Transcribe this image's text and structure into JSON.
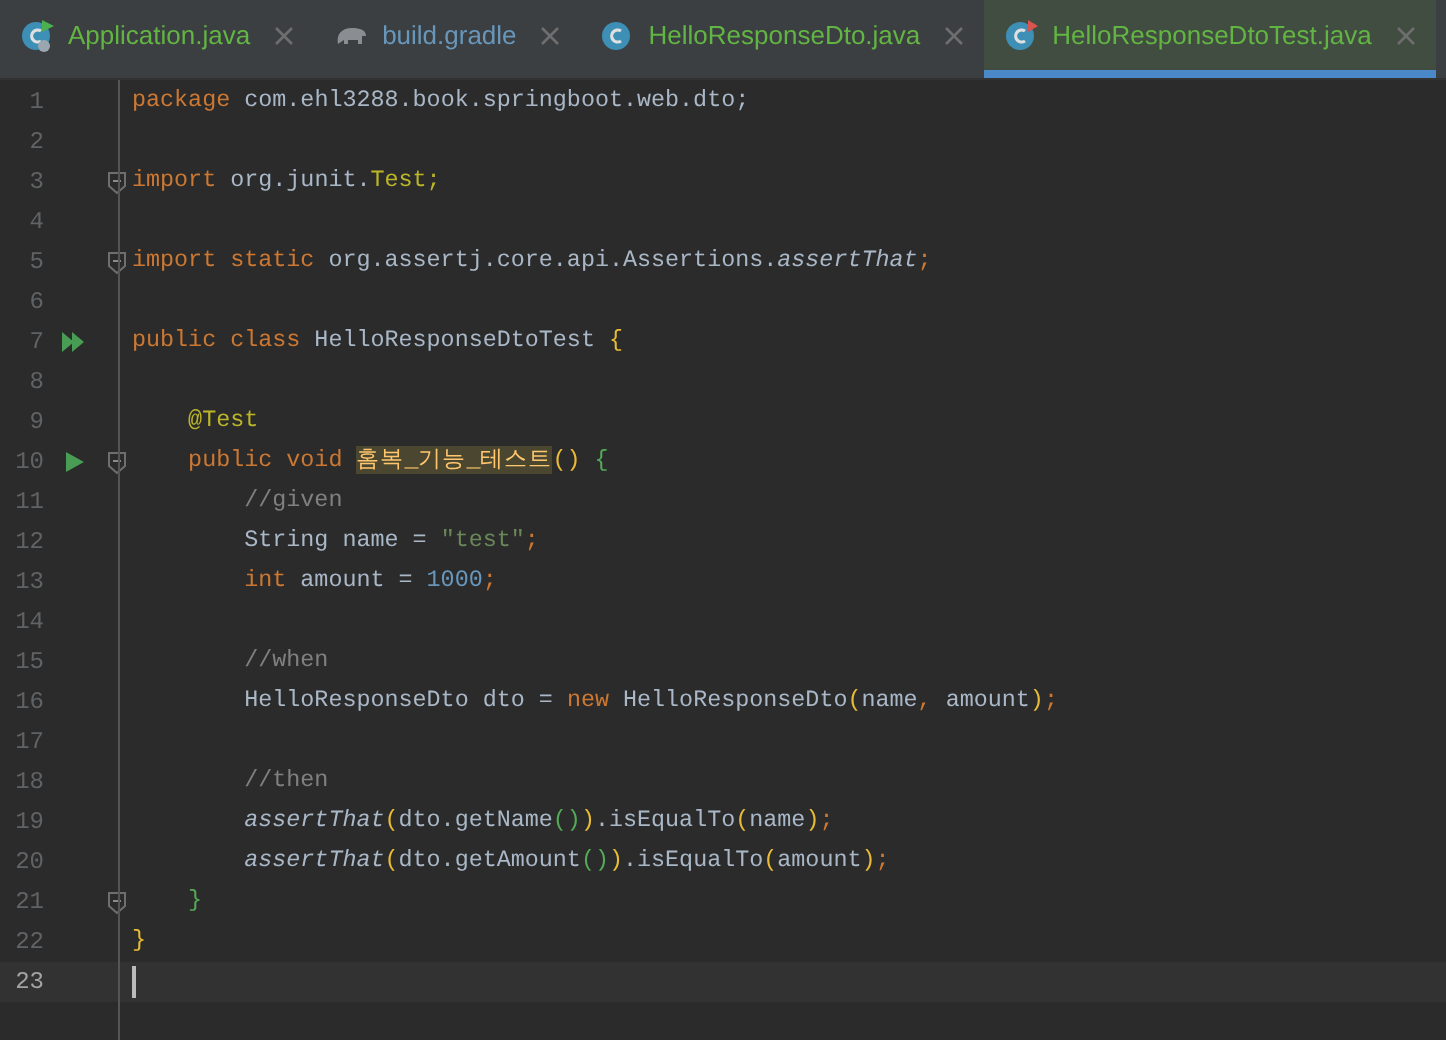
{
  "tabs": [
    {
      "label": "Application.java",
      "kind": "spring-class",
      "color": "#62b543",
      "selected": false
    },
    {
      "label": "build.gradle",
      "kind": "gradle",
      "color": "#6897bb",
      "selected": false
    },
    {
      "label": "HelloResponseDto.java",
      "kind": "class",
      "color": "#62b543",
      "selected": false
    },
    {
      "label": "HelloResponseDtoTest.java",
      "kind": "test-class",
      "color": "#62b543",
      "selected": true
    }
  ],
  "lines": [
    {
      "number": "1",
      "kind": "code",
      "fold": false,
      "current": false,
      "tokens": [
        {
          "text": "package",
          "kind": "kw"
        },
        {
          "text": " com.ehl3288.book.springboot.web.dto;",
          "kind": "plain"
        }
      ]
    },
    {
      "number": "2",
      "kind": "code",
      "fold": false,
      "current": false
    },
    {
      "number": "3",
      "kind": "code",
      "fold": true,
      "current": false,
      "tokens": [
        {
          "text": "import",
          "kind": "kw"
        },
        {
          "text": " org.junit.",
          "kind": "plain"
        },
        {
          "text": "Test;",
          "kind": "anno"
        }
      ]
    },
    {
      "number": "4",
      "kind": "code",
      "fold": false,
      "current": false
    },
    {
      "number": "5",
      "kind": "code",
      "fold": true,
      "current": false,
      "tokens": [
        {
          "text": "import static",
          "kind": "kw"
        },
        {
          "text": " org.assertj.core.api.Assertions.",
          "kind": "plain"
        },
        {
          "text": "assertThat",
          "kind": "italic"
        },
        {
          "text": ";",
          "kind": "kw"
        }
      ]
    },
    {
      "number": "6",
      "kind": "code",
      "fold": false,
      "current": false
    },
    {
      "number": "7",
      "kind": "run-all",
      "fold": false,
      "current": false,
      "tokens": [
        {
          "text": "public class",
          "kind": "kw"
        },
        {
          "text": " HelloResponseDtoTest ",
          "kind": "plain"
        },
        {
          "text": "{",
          "kind": "b1"
        }
      ]
    },
    {
      "number": "8",
      "kind": "code",
      "fold": false,
      "current": false
    },
    {
      "number": "9",
      "kind": "code",
      "fold": false,
      "current": false,
      "tokens": [
        {
          "text": "    @Test",
          "kind": "anno"
        }
      ]
    },
    {
      "number": "10",
      "kind": "run",
      "fold": true,
      "current": false,
      "tokens": [
        {
          "text": "    public void ",
          "kind": "kw"
        },
        {
          "text": "홈복_기능_테스트",
          "kind": "hl"
        },
        {
          "text": "() ",
          "kind": "b1"
        },
        {
          "text": "{",
          "kind": "b2"
        }
      ]
    },
    {
      "number": "11",
      "kind": "code",
      "fold": false,
      "current": false,
      "tokens": [
        {
          "text": "        //given",
          "kind": "comment"
        }
      ]
    },
    {
      "number": "12",
      "kind": "code",
      "fold": false,
      "current": false,
      "tokens": [
        {
          "text": "        String name = ",
          "kind": "plain"
        },
        {
          "text": "\"test\"",
          "kind": "str"
        },
        {
          "text": ";",
          "kind": "kw"
        }
      ]
    },
    {
      "number": "13",
      "kind": "code",
      "fold": false,
      "current": false,
      "tokens": [
        {
          "text": "        int",
          "kind": "kw"
        },
        {
          "text": " amount = ",
          "kind": "plain"
        },
        {
          "text": "1000",
          "kind": "num"
        },
        {
          "text": ";",
          "kind": "kw"
        }
      ]
    },
    {
      "number": "14",
      "kind": "code",
      "fold": false,
      "current": false
    },
    {
      "number": "15",
      "kind": "code",
      "fold": false,
      "current": false,
      "tokens": [
        {
          "text": "        //when",
          "kind": "comment"
        }
      ]
    },
    {
      "number": "16",
      "kind": "code",
      "fold": false,
      "current": false,
      "tokens": [
        {
          "text": "        HelloResponseDto dto = ",
          "kind": "plain"
        },
        {
          "text": "new",
          "kind": "kw"
        },
        {
          "text": " HelloResponseDto",
          "kind": "plain"
        },
        {
          "text": "(",
          "kind": "b1"
        },
        {
          "text": "name",
          "kind": "plain"
        },
        {
          "text": ",",
          "kind": "kw"
        },
        {
          "text": " amount",
          "kind": "plain"
        },
        {
          "text": ")",
          "kind": "b1"
        },
        {
          "text": ";",
          "kind": "kw"
        }
      ]
    },
    {
      "number": "17",
      "kind": "code",
      "fold": false,
      "current": false
    },
    {
      "number": "18",
      "kind": "code",
      "fold": false,
      "current": false,
      "tokens": [
        {
          "text": "        //then",
          "kind": "comment"
        }
      ]
    },
    {
      "number": "19",
      "kind": "code",
      "fold": false,
      "current": false,
      "tokens": [
        {
          "text": "        assertThat",
          "kind": "italic"
        },
        {
          "text": "(",
          "kind": "b1"
        },
        {
          "text": "dto.getName",
          "kind": "plain"
        },
        {
          "text": "()",
          "kind": "b2"
        },
        {
          "text": ")",
          "kind": "b1"
        },
        {
          "text": ".isEqualTo",
          "kind": "plain"
        },
        {
          "text": "(",
          "kind": "b1"
        },
        {
          "text": "name",
          "kind": "plain"
        },
        {
          "text": ")",
          "kind": "b1"
        },
        {
          "text": ";",
          "kind": "kw"
        }
      ]
    },
    {
      "number": "20",
      "kind": "code",
      "fold": false,
      "current": false,
      "tokens": [
        {
          "text": "        assertThat",
          "kind": "italic"
        },
        {
          "text": "(",
          "kind": "b1"
        },
        {
          "text": "dto.getAmount",
          "kind": "plain"
        },
        {
          "text": "()",
          "kind": "b2"
        },
        {
          "text": ")",
          "kind": "b1"
        },
        {
          "text": ".isEqualTo",
          "kind": "plain"
        },
        {
          "text": "(",
          "kind": "b1"
        },
        {
          "text": "amount",
          "kind": "plain"
        },
        {
          "text": ")",
          "kind": "b1"
        },
        {
          "text": ";",
          "kind": "kw"
        }
      ]
    },
    {
      "number": "21",
      "kind": "code",
      "fold": true,
      "current": false,
      "tokens": [
        {
          "text": "    }",
          "kind": "b2"
        }
      ]
    },
    {
      "number": "22",
      "kind": "code",
      "fold": false,
      "current": false,
      "tokens": [
        {
          "text": "}",
          "kind": "b1"
        }
      ]
    },
    {
      "number": "23",
      "kind": "code",
      "fold": false,
      "current": true
    }
  ]
}
